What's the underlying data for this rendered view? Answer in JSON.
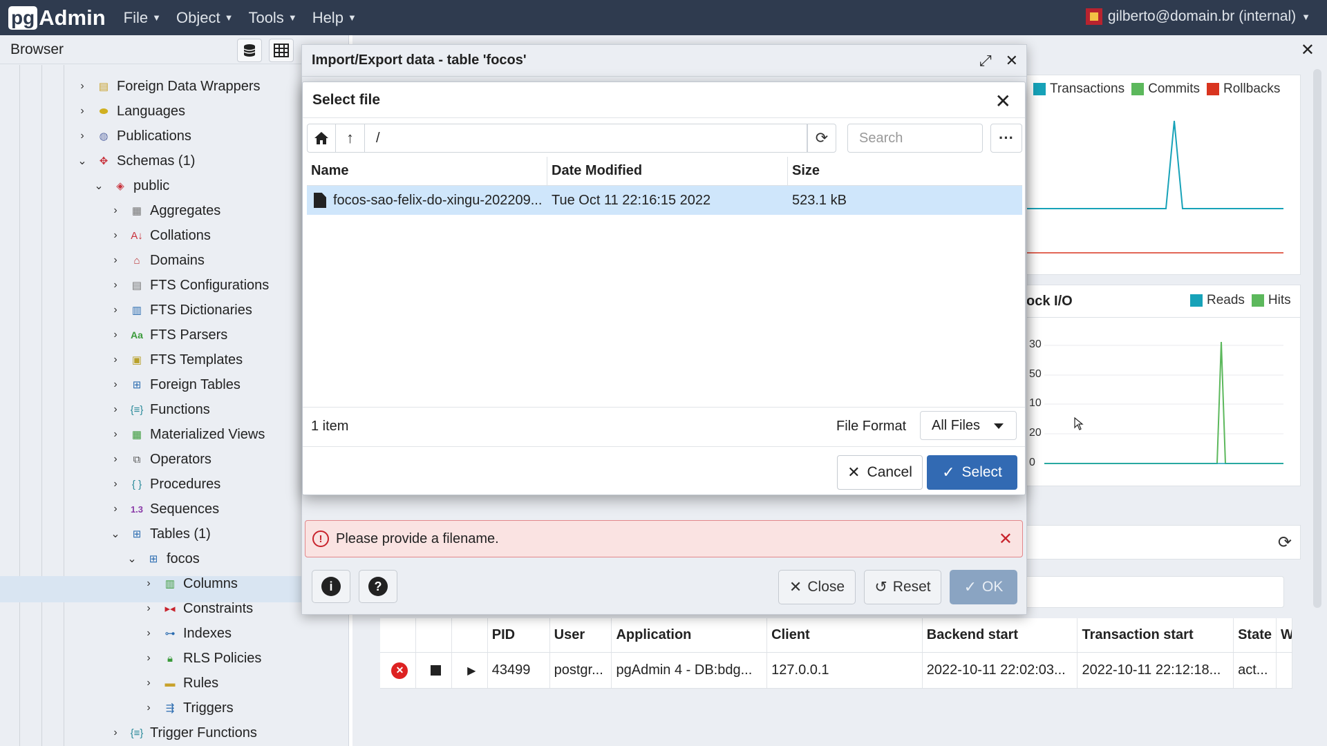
{
  "app": {
    "logo_pg": "pg",
    "logo_rest": "Admin",
    "menu": [
      "File",
      "Object",
      "Tools",
      "Help"
    ],
    "user": "gilberto@domain.br (internal)"
  },
  "browser": {
    "title": "Browser",
    "tree": [
      {
        "label": "Foreign Data Wrappers",
        "icon": "foreign-data-wrapper-icon"
      },
      {
        "label": "Languages",
        "icon": "language-icon"
      },
      {
        "label": "Publications",
        "icon": "publication-icon"
      },
      {
        "label": "Schemas (1)",
        "icon": "schema-icon"
      },
      {
        "label": "public",
        "icon": "public-schema-icon"
      },
      {
        "label": "Aggregates",
        "icon": "aggregate-icon"
      },
      {
        "label": "Collations",
        "icon": "collation-icon"
      },
      {
        "label": "Domains",
        "icon": "domain-icon"
      },
      {
        "label": "FTS Configurations",
        "icon": "fts-configuration-icon"
      },
      {
        "label": "FTS Dictionaries",
        "icon": "fts-dictionary-icon"
      },
      {
        "label": "FTS Parsers",
        "icon": "fts-parser-icon"
      },
      {
        "label": "FTS Templates",
        "icon": "fts-template-icon"
      },
      {
        "label": "Foreign Tables",
        "icon": "foreign-table-icon"
      },
      {
        "label": "Functions",
        "icon": "function-icon"
      },
      {
        "label": "Materialized Views",
        "icon": "materialized-view-icon"
      },
      {
        "label": "Operators",
        "icon": "operator-icon"
      },
      {
        "label": "Procedures",
        "icon": "procedure-icon"
      },
      {
        "label": "Sequences",
        "icon": "sequence-icon"
      },
      {
        "label": "Tables (1)",
        "icon": "table-icon"
      },
      {
        "label": "focos",
        "icon": "table-icon"
      },
      {
        "label": "Columns",
        "icon": "column-icon"
      },
      {
        "label": "Constraints",
        "icon": "constraint-icon"
      },
      {
        "label": "Indexes",
        "icon": "index-icon"
      },
      {
        "label": "RLS Policies",
        "icon": "rls-policy-icon"
      },
      {
        "label": "Rules",
        "icon": "rule-icon"
      },
      {
        "label": "Triggers",
        "icon": "trigger-icon"
      },
      {
        "label": "Trigger Functions",
        "icon": "trigger-function-icon"
      }
    ]
  },
  "dashboard": {
    "legend1": [
      "Transactions",
      "Commits",
      "Rollbacks"
    ],
    "legend1_colors": [
      "#17a2b8",
      "#5cb85c",
      "#d9341f"
    ],
    "block_io_title": "ock I/O",
    "legend2": [
      "Reads",
      "Hits"
    ],
    "legend2_colors": [
      "#17a2b8",
      "#5cb85c"
    ],
    "y_ticks": [
      "30",
      "50",
      "10",
      "20",
      "0"
    ]
  },
  "import_export": {
    "title": "Import/Export data - table 'focos'",
    "alert": "Please provide a filename.",
    "close": "Close",
    "reset": "Reset",
    "ok": "OK"
  },
  "select_file": {
    "title": "Select file",
    "path": "/",
    "search_placeholder": "Search",
    "columns": [
      "Name",
      "Date Modified",
      "Size"
    ],
    "rows": [
      {
        "name": "focos-sao-felix-do-xingu-202209...",
        "modified": "Tue Oct 11 22:16:15 2022",
        "size": "523.1 kB"
      }
    ],
    "count": "1 item",
    "file_format_label": "File Format",
    "file_format_value": "All Files",
    "cancel": "Cancel",
    "select": "Select"
  },
  "sessions": {
    "columns": [
      "PID",
      "User",
      "Application",
      "Client",
      "Backend start",
      "Transaction start",
      "State",
      "W"
    ],
    "row": [
      "43499",
      "postgr...",
      "pgAdmin 4 - DB:bdg...",
      "127.0.0.1",
      "2022-10-11 22:02:03...",
      "2022-10-11 22:12:18...",
      "act..."
    ]
  }
}
